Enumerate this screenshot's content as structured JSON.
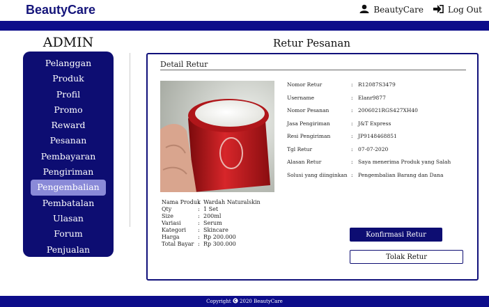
{
  "brand": "BeautyCare",
  "topnav": {
    "user_label": "BeautyCare",
    "logout_label": "Log Out"
  },
  "sidebar": {
    "title": "ADMIN",
    "items": [
      {
        "label": "Pelanggan"
      },
      {
        "label": "Produk"
      },
      {
        "label": "Profil"
      },
      {
        "label": "Promo"
      },
      {
        "label": "Reward"
      },
      {
        "label": "Pesanan"
      },
      {
        "label": "Pembayaran"
      },
      {
        "label": "Pengiriman"
      },
      {
        "label": "Pengembalian",
        "active": true
      },
      {
        "label": "Pembatalan"
      },
      {
        "label": "Ulasan"
      },
      {
        "label": "Forum"
      },
      {
        "label": "Penjualan"
      }
    ]
  },
  "main": {
    "title": "Retur Pesanan",
    "section_title": "Detail Retur",
    "product": [
      {
        "key": "Nama Produk",
        "value": "Wardah Naturalskin"
      },
      {
        "key": "Qty",
        "value": "1 Set"
      },
      {
        "key": "Size",
        "value": "200ml"
      },
      {
        "key": "Variasi",
        "value": "Serum"
      },
      {
        "key": "Kategori",
        "value": "Skincare"
      },
      {
        "key": "Harga",
        "value": "Rp 200.000"
      },
      {
        "key": "Total  Bayar",
        "value": " Rp 300.000"
      }
    ],
    "info": [
      {
        "key": "Nomor Retur",
        "value": "R12087S3479"
      },
      {
        "key": "Username",
        "value": "Elanr9877"
      },
      {
        "key": "Nomor Pesanan",
        "value": "2006021RGS427XH40"
      },
      {
        "key": "Jasa Pengiriman",
        "value": "J&T Express"
      },
      {
        "key": "Resi Pengiriman",
        "value": "JP9148468851"
      },
      {
        "key": "Tgl Retur",
        "value": "07-07-2020"
      },
      {
        "key": "Alasan Retur",
        "value": "Saya menerima Produk yang Salah"
      },
      {
        "key": "Solusi yang diinginkan",
        "value": "Pengembalian Barang dan Dana"
      }
    ],
    "confirm_button": "Konfirmasi Retur",
    "reject_button": "Tolak Retur"
  },
  "footer": {
    "prefix": "Copyright",
    "text": "2020 BeautyCare"
  },
  "colors": {
    "primary": "#0d0d8a",
    "sidebar": "#0d0d72",
    "active": "#8a8ad8"
  },
  "icons": [
    "user-icon",
    "logout-icon",
    "copyright-icon"
  ]
}
